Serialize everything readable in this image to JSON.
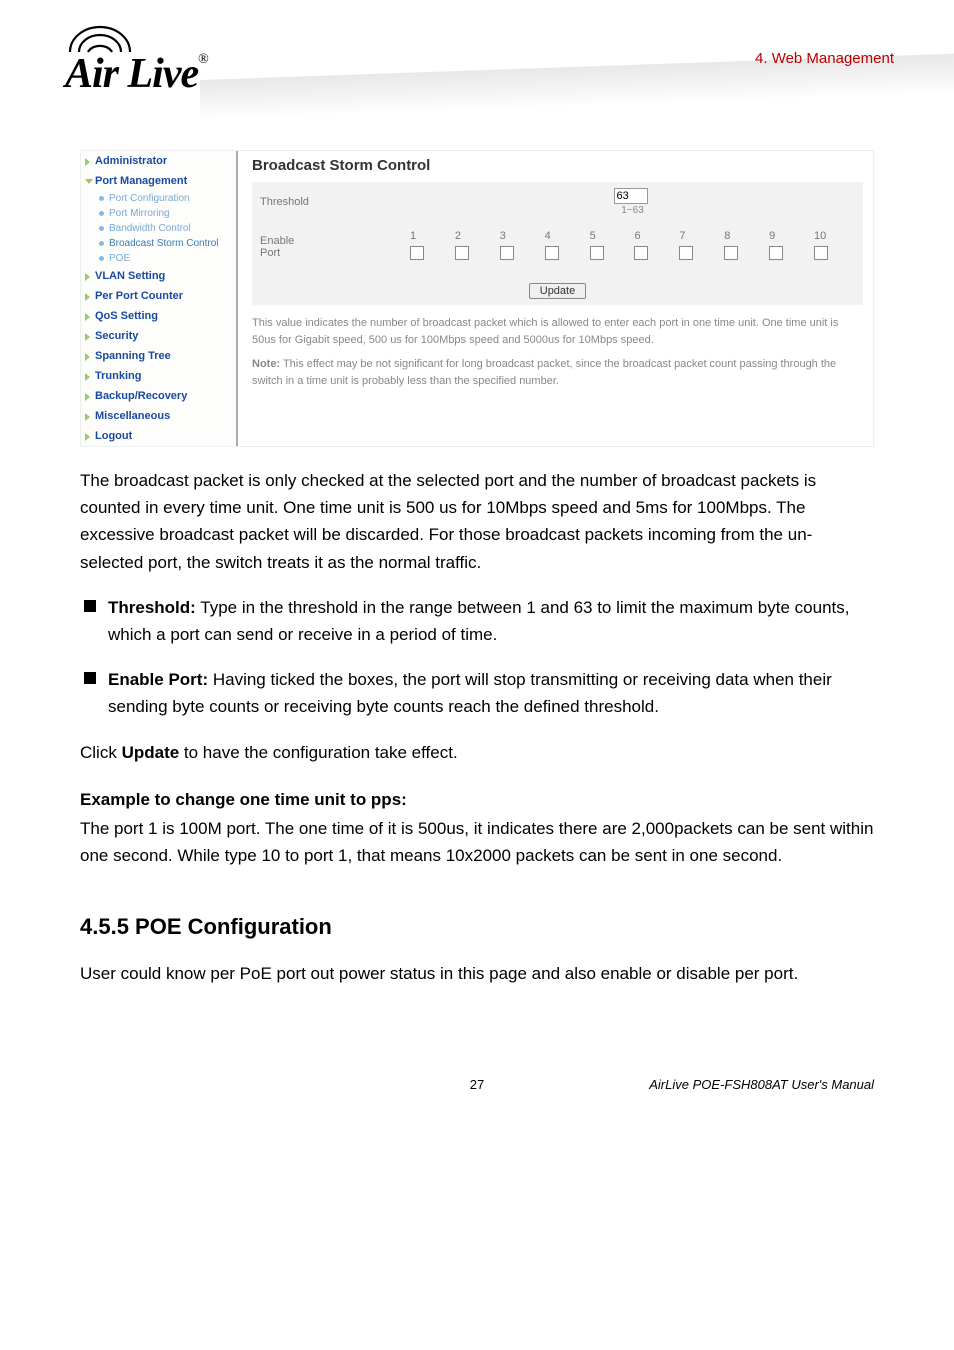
{
  "header": {
    "logo_text": "Air Live",
    "reg_mark": "®",
    "section_label": "4. Web Management"
  },
  "screenshot": {
    "sidebar": {
      "items": [
        {
          "label": "Administrator",
          "open": false
        },
        {
          "label": "Port Management",
          "open": true,
          "children": [
            {
              "label": "Port Configuration"
            },
            {
              "label": "Port Mirroring"
            },
            {
              "label": "Bandwidth Control"
            },
            {
              "label": "Broadcast Storm Control",
              "active": true
            },
            {
              "label": "POE"
            }
          ]
        },
        {
          "label": "VLAN Setting",
          "open": false
        },
        {
          "label": "Per Port Counter",
          "open": false
        },
        {
          "label": "QoS Setting",
          "open": false
        },
        {
          "label": "Security",
          "open": false
        },
        {
          "label": "Spanning Tree",
          "open": false
        },
        {
          "label": "Trunking",
          "open": false
        },
        {
          "label": "Backup/Recovery",
          "open": false
        },
        {
          "label": "Miscellaneous",
          "open": false
        },
        {
          "label": "Logout",
          "open": false
        }
      ]
    },
    "panel": {
      "title": "Broadcast Storm Control",
      "threshold_label": "Threshold",
      "threshold_value": "63",
      "threshold_range": "1~63",
      "enable_port_label": "Enable\nPort",
      "ports": [
        "1",
        "2",
        "3",
        "4",
        "5",
        "6",
        "7",
        "8",
        "9",
        "10"
      ],
      "update_btn": "Update",
      "note1": "This value indicates the number of broadcast packet which is allowed to enter each port in one time unit. One time unit is 50us for Gigabit speed, 500 us for 100Mbps speed and 5000us for 10Mbps speed.",
      "note2_prefix": "Note:",
      "note2": " This effect may be not significant for long broadcast packet, since the broadcast packet count passing through the switch in a time unit is probably less than the specified number."
    }
  },
  "body": {
    "para1": "The broadcast packet is only checked at the selected port and the number of broadcast packets is counted in every time unit. One time unit is 500 us for 10Mbps speed and 5ms for 100Mbps. The excessive broadcast packet will be discarded. For those broadcast packets incoming from the un-selected port, the switch treats it as the normal traffic.",
    "bullet1_label": "Threshold:",
    "bullet1": " Type in the threshold in the range between 1 and 63 to limit the maximum byte counts, which a port can send or receive in a period of time.",
    "bullet2_label": "Enable Port:",
    "bullet2": " Having ticked the boxes, the port will stop transmitting or receiving data when their sending byte counts or receiving byte counts reach the defined threshold.",
    "click_update": "Click ",
    "click_update_bold": "Update",
    "click_update_after": " to have the configuration take effect.",
    "example_heading": "Example to change one time unit to pps:",
    "example_body": "The port 1 is 100M port. The one time of it is 500us, it indicates there are 2,000packets can be sent within one second. While type 10 to port 1, that means 10x2000 packets can be sent in one second.",
    "subsection_title": "4.5.5 POE Configuration",
    "subsection_body": "User could know per PoE port out power status in this page and also enable or disable per port."
  },
  "footer": {
    "page_number": "27",
    "manual_title": "AirLive POE-FSH808AT User's Manual"
  }
}
